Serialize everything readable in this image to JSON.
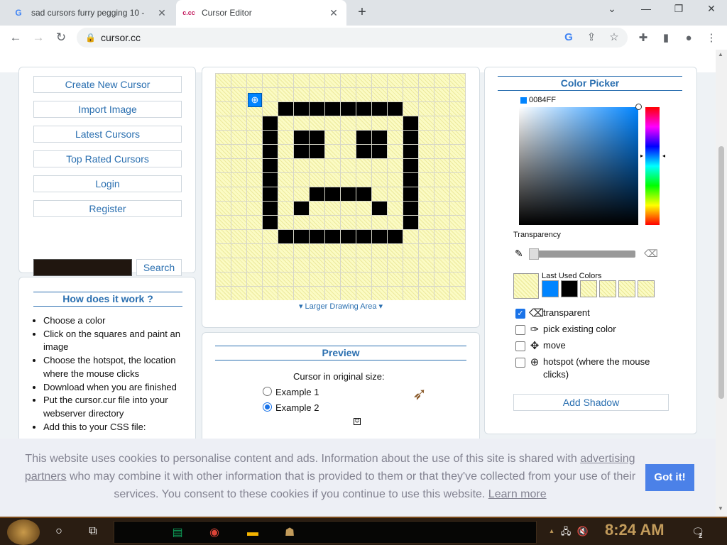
{
  "browser": {
    "tabs": [
      {
        "title": "sad cursors furry pegging 10 - ",
        "favicon": "google-g-icon"
      },
      {
        "title": "Cursor Editor",
        "favicon": "cursor-cc-icon"
      }
    ],
    "url": "cursor.cc"
  },
  "sidebar": {
    "links": [
      "Create New Cursor",
      "Import Image",
      "Latest Cursors",
      "Top Rated Cursors",
      "Login",
      "Register"
    ],
    "search_button": "Search"
  },
  "how": {
    "title": "How does it work ?",
    "steps": [
      "Choose a color",
      "Click on the squares and paint an image",
      "Choose the hotspot, the location where the mouse clicks",
      "Download when you are finished",
      "Put the cursor.cur file into your webserver directory",
      "Add this to your CSS file:"
    ]
  },
  "editor": {
    "larger_label": "Larger Drawing Area",
    "grid_cols": 16,
    "grid_rows": 16,
    "hotspot_cell": [
      2,
      1
    ],
    "black_pixels": [
      [
        4,
        2
      ],
      [
        5,
        2
      ],
      [
        6,
        2
      ],
      [
        7,
        2
      ],
      [
        8,
        2
      ],
      [
        9,
        2
      ],
      [
        10,
        2
      ],
      [
        11,
        2
      ],
      [
        3,
        3
      ],
      [
        12,
        3
      ],
      [
        3,
        4
      ],
      [
        5,
        4
      ],
      [
        6,
        4
      ],
      [
        9,
        4
      ],
      [
        10,
        4
      ],
      [
        12,
        4
      ],
      [
        3,
        5
      ],
      [
        5,
        5
      ],
      [
        6,
        5
      ],
      [
        9,
        5
      ],
      [
        10,
        5
      ],
      [
        12,
        5
      ],
      [
        3,
        6
      ],
      [
        12,
        6
      ],
      [
        3,
        7
      ],
      [
        12,
        7
      ],
      [
        3,
        8
      ],
      [
        6,
        8
      ],
      [
        7,
        8
      ],
      [
        8,
        8
      ],
      [
        9,
        8
      ],
      [
        12,
        8
      ],
      [
        3,
        9
      ],
      [
        5,
        9
      ],
      [
        10,
        9
      ],
      [
        12,
        9
      ],
      [
        3,
        10
      ],
      [
        12,
        10
      ],
      [
        4,
        11
      ],
      [
        5,
        11
      ],
      [
        6,
        11
      ],
      [
        7,
        11
      ],
      [
        8,
        11
      ],
      [
        9,
        11
      ],
      [
        10,
        11
      ],
      [
        11,
        11
      ]
    ]
  },
  "preview": {
    "title": "Preview",
    "original_size_label": "Cursor in original size:",
    "example1": "Example 1",
    "example2": "Example 2",
    "selected": "Example 2"
  },
  "colorpicker": {
    "title": "Color Picker",
    "hex": "0084FF",
    "hex_color": "#0084FF",
    "transparency_label": "Transparency",
    "last_used_label": "Last Used Colors",
    "last_used": [
      "#0084FF",
      "#000000",
      "transparent",
      "transparent",
      "transparent",
      "transparent"
    ],
    "options": [
      {
        "label": "transparent",
        "checked": true,
        "icon": "eraser-icon"
      },
      {
        "label": "pick existing color",
        "checked": false,
        "icon": "eyedropper-icon"
      },
      {
        "label": "move",
        "checked": false,
        "icon": "move-icon"
      },
      {
        "label": "hotspot (where the mouse clicks)",
        "checked": false,
        "icon": "crosshair-icon"
      }
    ],
    "add_shadow": "Add Shadow"
  },
  "cookie": {
    "text_part1": "This website uses cookies to personalise content and ads. Information about the use of this site is shared with ",
    "link1": "advertising partners",
    "text_part2": " who may combine it with other information that is provided to them or that they've collected from your use of their services. You consent to these cookies if you continue to use this website. ",
    "link2": "Learn more",
    "button": "Got it!"
  },
  "taskbar": {
    "time": "8:24 AM",
    "notification_count": "2"
  }
}
